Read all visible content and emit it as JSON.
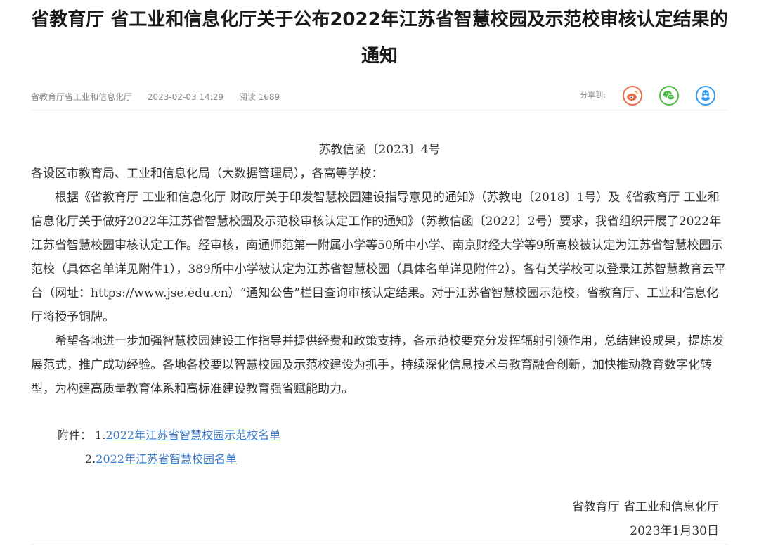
{
  "article": {
    "title": "省教育厅 省工业和信息化厅关于公布2022年江苏省智慧校园及示范校审核认定结果的通知",
    "meta": {
      "source": "省教育厅省工业和信息化厅",
      "datetime": "2023-02-03 14:29",
      "views": "阅读 1689"
    },
    "share": {
      "label": "分享到:",
      "icons": [
        "weibo-icon",
        "wechat-icon",
        "qq-icon"
      ]
    }
  },
  "body": {
    "doc_number": "苏教信函〔2023〕4号",
    "recipients": "各设区市教育局、工业和信息化局（大数据管理局），各高等学校：",
    "paragraphs": [
      "根据《省教育厅 工业和信息化厅 财政厅关于印发智慧校园建设指导意见的通知》（苏教电〔2018〕1号）及《省教育厅 工业和信息化厅关于做好2022年江苏省智慧校园及示范校审核认定工作的通知》（苏教信函〔2022〕2号）要求，我省组织开展了2022年江苏省智慧校园审核认定工作。经审核，南通师范第一附属小学等50所中小学、南京财经大学等9所高校被认定为江苏省智慧校园示范校（具体名单详见附件1），389所中小学被认定为江苏省智慧校园（具体名单详见附件2）。各有关学校可以登录江苏智慧教育云平台（网址：https://www.jse.edu.cn）“通知公告”栏目查询审核认定结果。对于江苏省智慧校园示范校，省教育厅、工业和信息化厅将授予铜牌。",
      "希望各地进一步加强智慧校园建设工作指导并提供经费和政策支持，各示范校要充分发挥辐射引领作用，总结建设成果，提炼发展范式，推广成功经验。各地各校要以智慧校园及示范校建设为抓手，持续深化信息技术与教育融合创新，加快推动教育数字化转型，为构建高质量教育体系和高标准建设教育强省赋能助力。"
    ]
  },
  "attachments": {
    "label": "附件：",
    "items": [
      {
        "prefix": "1.",
        "text": "2022年江苏省智慧校园示范校名单"
      },
      {
        "prefix": "2.",
        "text": "2022年江苏省智慧校园名单"
      }
    ]
  },
  "signature": {
    "org": "省教育厅 省工业和信息化厅",
    "date": "2023年1月30日"
  },
  "colors": {
    "link": "#3c78c3",
    "weibo": "#e8704a",
    "wechat": "#4fb648",
    "qq": "#3d9be9"
  }
}
